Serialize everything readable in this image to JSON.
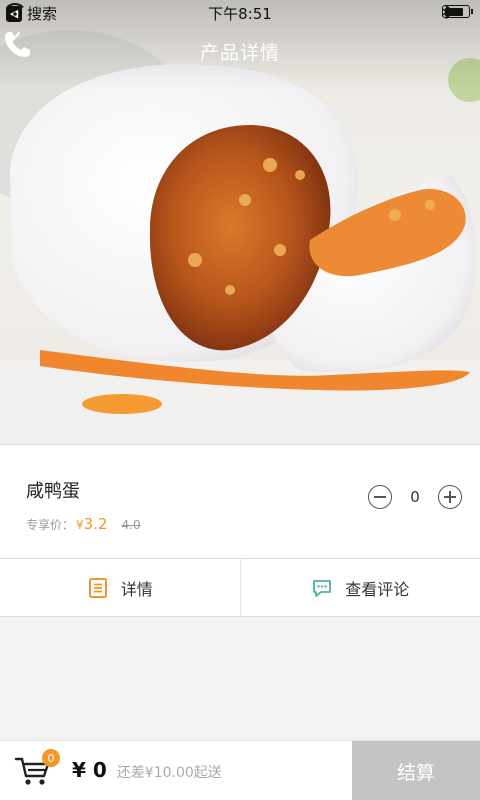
{
  "status_bar": {
    "back_app_label": "搜索",
    "time": "下午8:51"
  },
  "nav": {
    "title": "产品详情"
  },
  "product": {
    "name": "咸鸭蛋",
    "price_label": "专享价：",
    "currency": "¥",
    "price": "3.2",
    "original_price": "4.0",
    "quantity": "0"
  },
  "tabs": [
    {
      "label": "详情",
      "icon": "document-icon"
    },
    {
      "label": "查看评论",
      "icon": "chat-bubble-icon"
    }
  ],
  "cart": {
    "badge_count": "0",
    "total": "¥ 0",
    "min_order_note": "还差¥10.00起送",
    "checkout_label": "结算"
  },
  "colors": {
    "accent": "#f0982b",
    "checkout_disabled": "#c4c4c4",
    "comment_icon": "#4fb3a3"
  }
}
